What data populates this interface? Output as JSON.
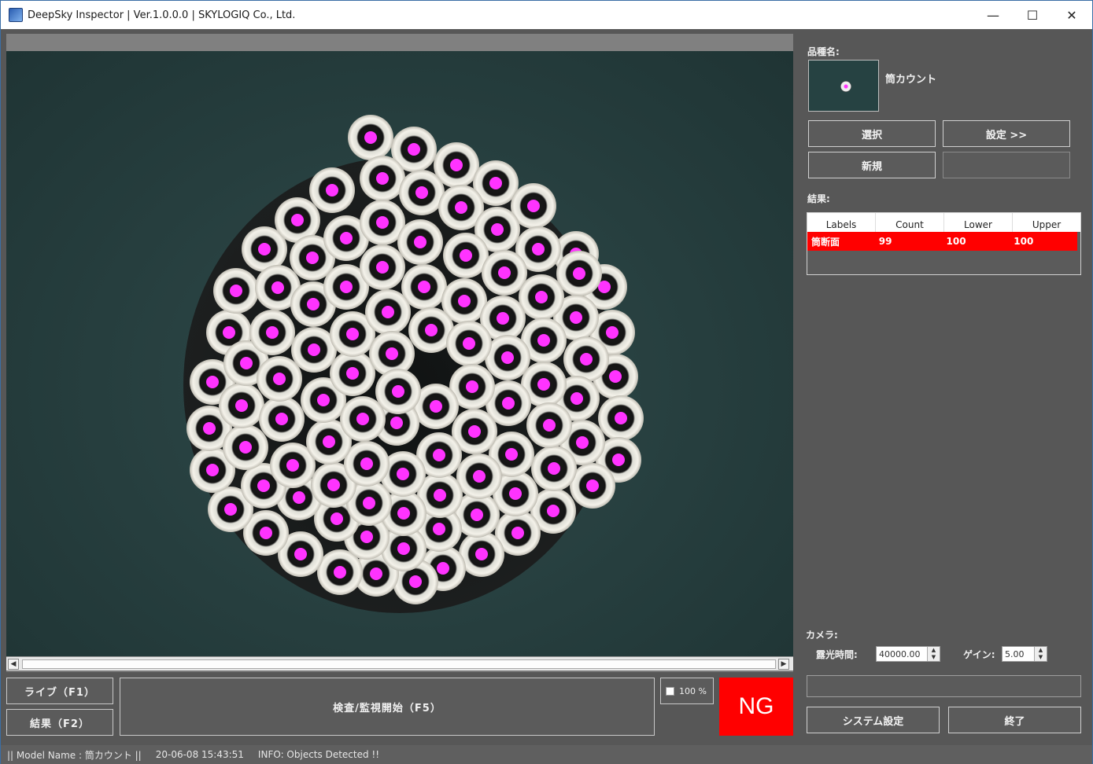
{
  "window": {
    "title": "DeepSky Inspector | Ver.1.0.0.0 | SKYLOGIQ Co., Ltd.",
    "minimize_glyph": "—",
    "maximize_glyph": "☐",
    "close_glyph": "✕"
  },
  "viewer": {
    "overlay_color": "#ff33ff",
    "background_color": "#263e3e",
    "detected_count": 99
  },
  "controls": {
    "live_label": "ライブ（F1）",
    "result_label": "結果（F2）",
    "start_label": "検査/監視開始（F5）",
    "zoom_label": "100 %",
    "zoom_checked": false,
    "judgement": "NG",
    "judgement_color": "#ff0000"
  },
  "right_panel": {
    "product_label": "品種名:",
    "product_name": "筒カウント",
    "select_button": "選択",
    "settings_button": "設定 >>",
    "new_button": "新規",
    "result_label": "結果:",
    "table": {
      "headers": [
        "Labels",
        "Count",
        "Lower",
        "Upper"
      ],
      "rows": [
        {
          "label": "筒断面",
          "count": "99",
          "lower": "100",
          "upper": "100",
          "status_color": "#ff0000"
        }
      ]
    },
    "camera_label": "カメラ:",
    "exposure_label": "露光時間:",
    "exposure_value": "40000.00",
    "gain_label": "ゲイン:",
    "gain_value": "5.00",
    "system_settings_button": "システム設定",
    "exit_button": "終了"
  },
  "statusbar": {
    "model": "|| Model Name : 筒カウント ||",
    "timestamp": "20-06-08 15:43:51",
    "info": "INFO:   Objects Detected !!"
  }
}
